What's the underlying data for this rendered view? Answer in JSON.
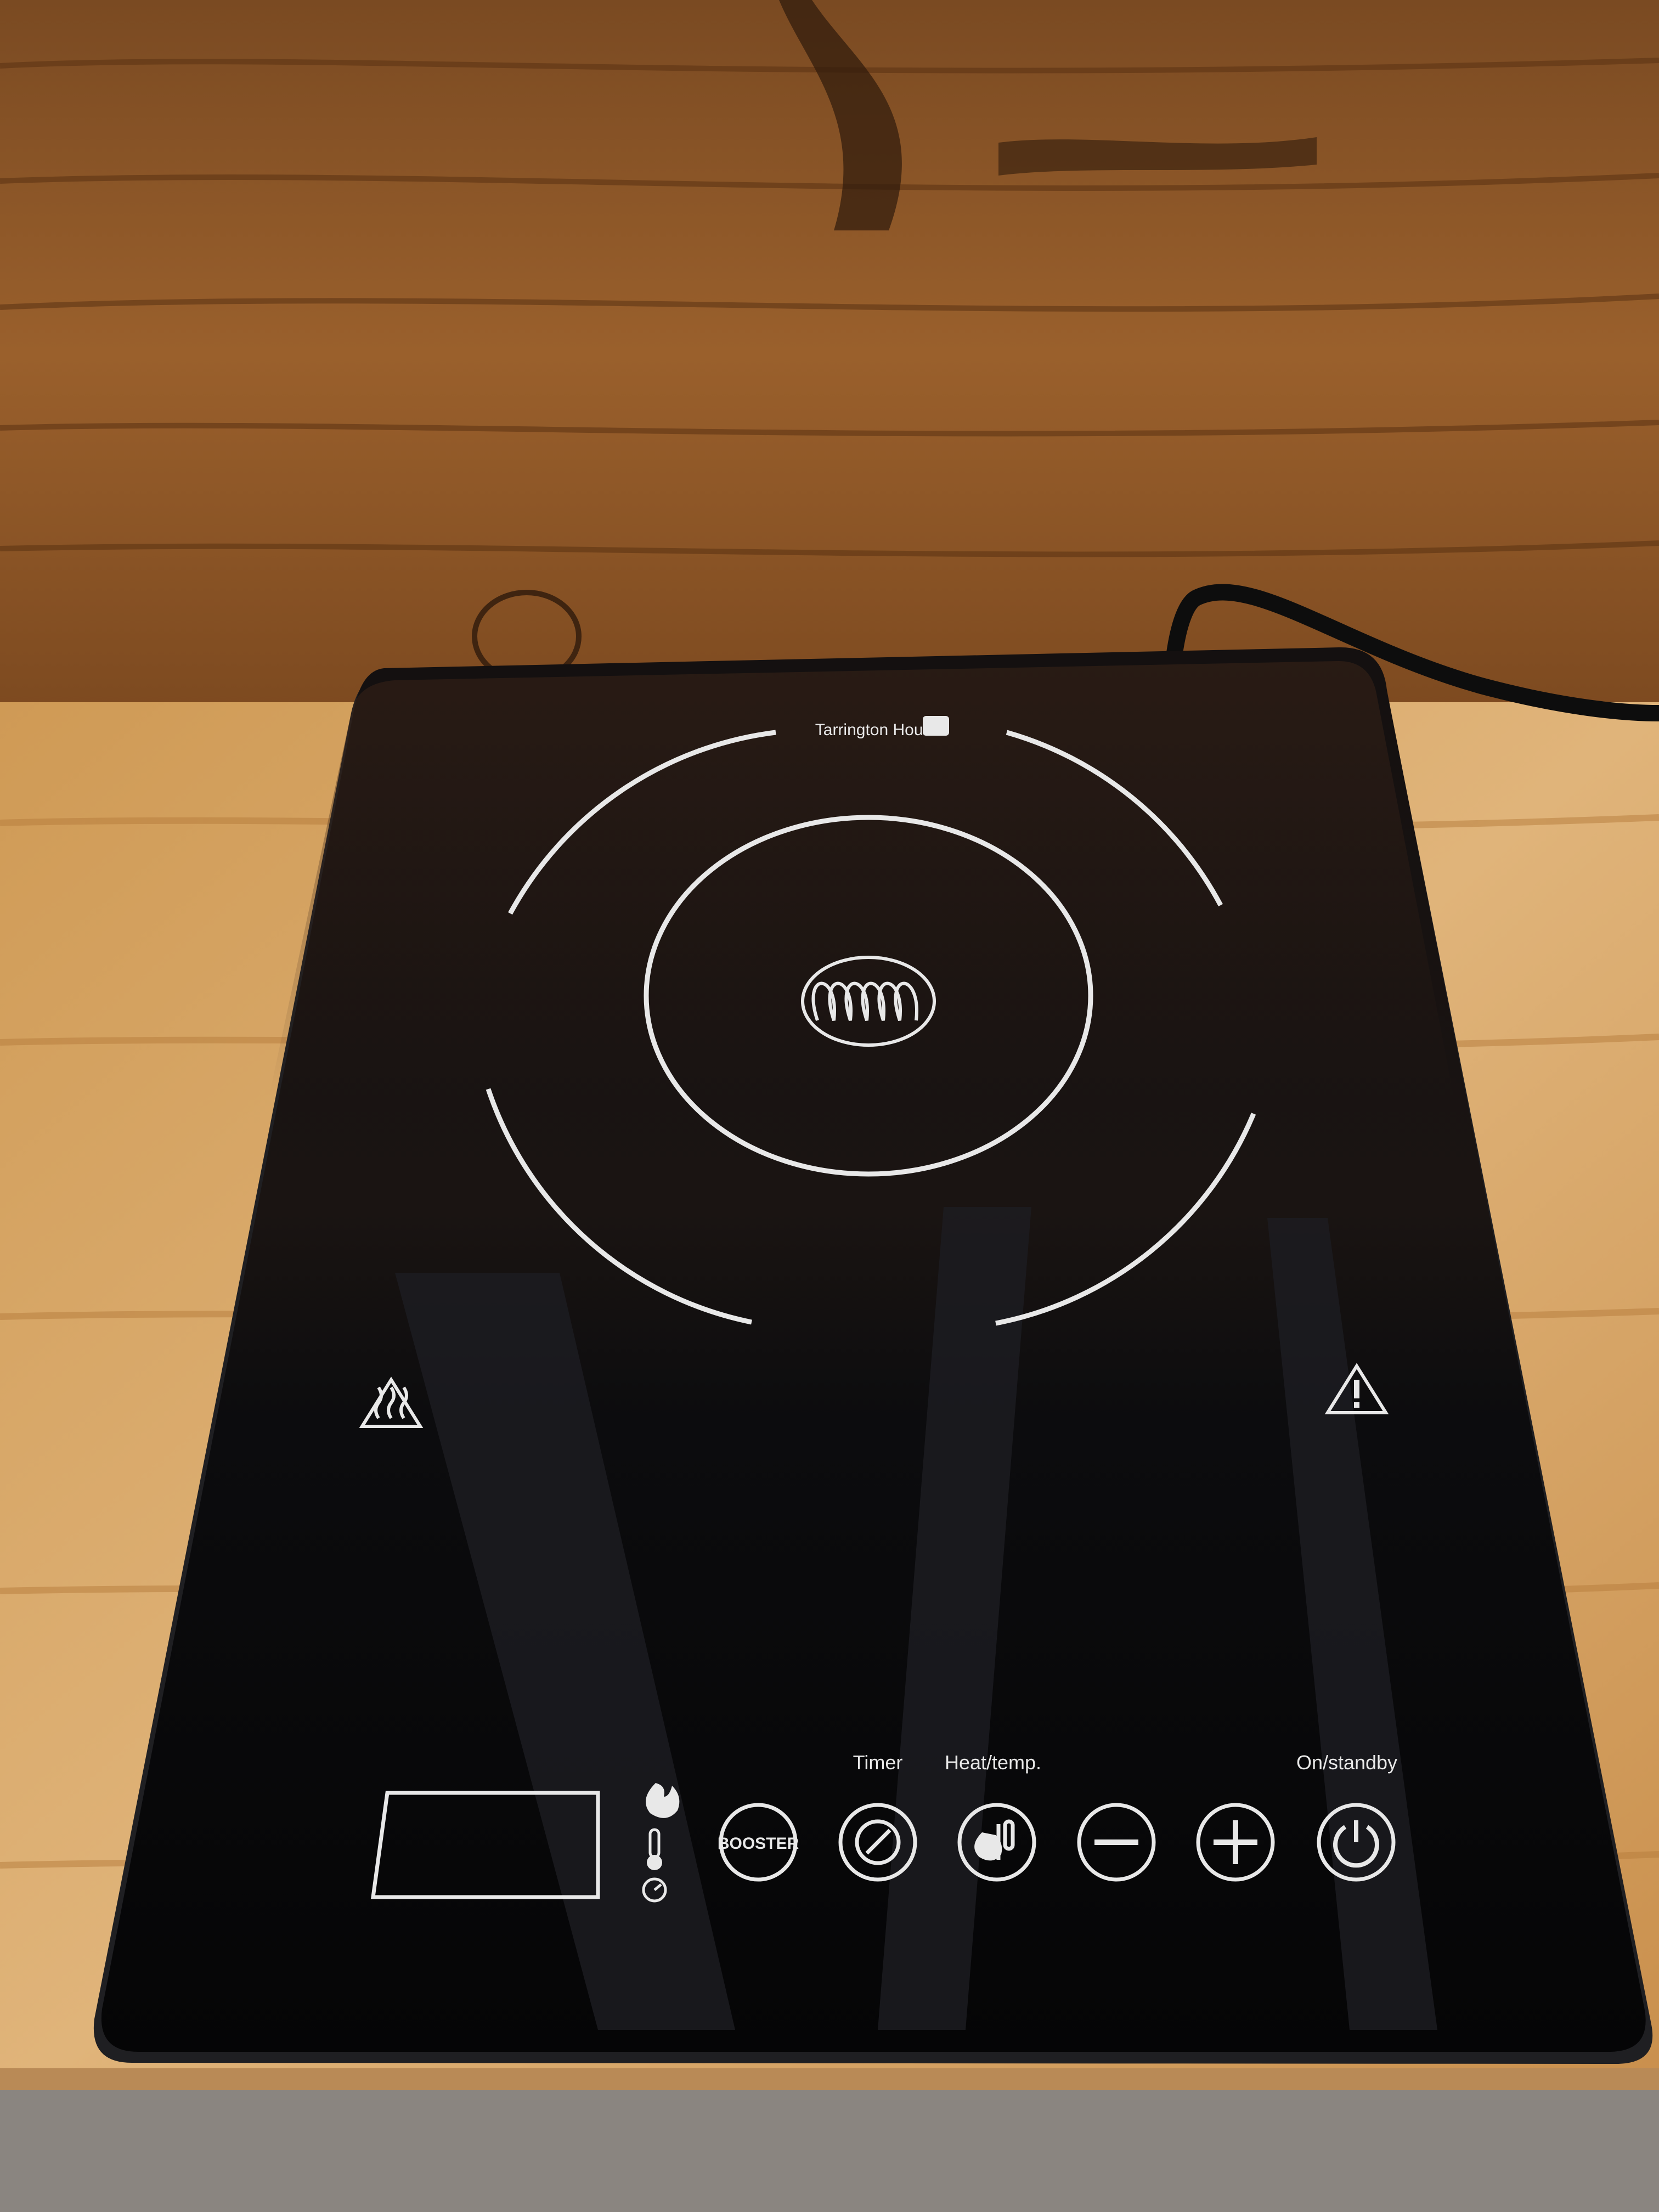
{
  "cooktop": {
    "brand": "Tarrington House",
    "labels": {
      "timer": "Timer",
      "heat_temp": "Heat/temp.",
      "on_standby": "On/standby"
    },
    "buttons": [
      {
        "name": "booster-button",
        "label": "BOOSTER"
      },
      {
        "name": "timer-button",
        "icon": "clock-icon"
      },
      {
        "name": "heat-temp-button",
        "icon": "flame-thermometer-icon"
      },
      {
        "name": "minus-button",
        "icon": "minus-icon"
      },
      {
        "name": "plus-button",
        "icon": "plus-icon"
      },
      {
        "name": "power-button",
        "icon": "power-icon"
      }
    ],
    "indicators": [
      "flame-icon",
      "thermometer-icon",
      "clock-icon"
    ],
    "warnings": [
      "hot-surface-icon",
      "warning-icon"
    ]
  },
  "colors": {
    "glass": "#0b0b0d",
    "print": "#e8e8e8",
    "wood_dark": "#6b3f1d",
    "wood_light": "#d6a565",
    "floor": "#8a8580"
  }
}
